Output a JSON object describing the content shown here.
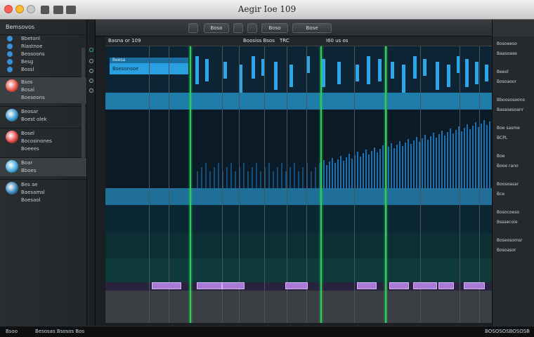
{
  "window": {
    "title": "Aegir Ioe 109"
  },
  "sidebar": {
    "header": "Bemsovos",
    "items": [
      {
        "label": "Bbetonl",
        "color": "#3a8fd6"
      },
      {
        "label": "Rlastnoe",
        "color": "#3a8fd6"
      },
      {
        "label": "Beosoons",
        "color": "#3a8fd6"
      },
      {
        "label": "Besg",
        "color": "#3a8fd6"
      },
      {
        "label": "Bossl",
        "color": "#3a8fd6"
      }
    ],
    "groups": [
      {
        "lines": [
          "Bsos",
          "Bosal",
          "Boeseons"
        ],
        "icon": "#e0443a"
      },
      {
        "lines": [
          "Beosar",
          "Boest olek"
        ],
        "icon": "#2a8ec8"
      },
      {
        "lines": [
          "Bosel",
          "Bocosinones",
          "Boeees"
        ],
        "icon": "#d83a3a"
      },
      {
        "lines": [
          "Boar",
          "Bboes"
        ],
        "icon": "#3aa0d6"
      },
      {
        "lines": [
          "Bes ae",
          "Baesamsl",
          "Boesaol"
        ],
        "icon": "#2a7ab0"
      }
    ]
  },
  "toolbar": {
    "tool1": "Boso",
    "tool2": "Boso",
    "tool3": "Bose"
  },
  "ruler": {
    "label1": "Basna or 109",
    "label2": "Boosiss Bsos",
    "label3": "TRC",
    "label4": "I60 us os"
  },
  "clip": {
    "name": "Bsesonsoe",
    "subname": "Beesa"
  },
  "right_panel": {
    "lines": [
      "Bosoeeso",
      "Baasoase",
      "Beeol",
      "Bosoaoor",
      "Bboososeono",
      "Basasesoanr",
      "Boe sasme",
      "BCPL",
      "Boe",
      "Booe rano",
      "Boosoasar",
      "Bce",
      "Bosocoeso",
      "Bsssecoie",
      "Boseosomsr",
      "Bosoasor"
    ]
  },
  "status": {
    "left": "Bsoo",
    "middle": "Besosas Bsosos Bos",
    "right": "BOSOSOSBOSOSB"
  },
  "colors": {
    "accent": "#2aa7e8",
    "playhead": "#2ecc5a",
    "clip": "#a97ad6"
  }
}
